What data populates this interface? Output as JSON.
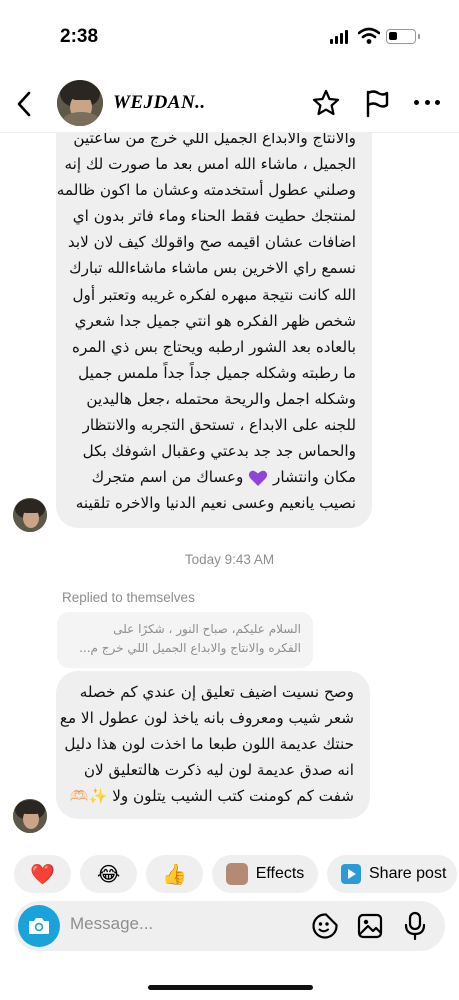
{
  "status_bar": {
    "time": "2:38"
  },
  "header": {
    "contact_name": "WEJDAN.."
  },
  "messages": [
    {
      "id": "msg-1",
      "lines": [
        "والانتاج والابداع الجميل اللي خرج من ساعتين",
        "الجميل ، ماشاء الله امس بعد ما صورت لك إنه",
        "وصلني عطول أستخدمته وعشان ما اكون ظالمه",
        "لمنتجك حطيت فقط الحناء وماء فاتر بدون اي",
        "اضافات عشان اقيمه صح واقولك كيف لان لابد",
        "نسمع راي الاخرين بس ماشاء ماشاءالله تبارك",
        "الله كانت نتيجة مبهره لفكره غريبه وتعتبر أول",
        "شخص ظهر الفكره هو انتي جميل جدا شعري",
        "بالعاده بعد الشور ارطبه ويحتاج بس ذي المره",
        "ما رطبته وشكله جميل جداً جداً ملمس جميل",
        "وشكله اجمل والريحة محتمله ،جعل هاليدين",
        "للجنه على الابداع ، تستحق التجربه والانتظار",
        "والحماس جد جد بدعتي وعقبال اشوفك بكل",
        "مكان وانتشار",
        "وعساك من اسم متجرك",
        "نصيب يانعيم وعسى نعيم الدنيا والاخره تلقينه"
      ]
    },
    {
      "id": "msg-2",
      "lines": [
        "وصح نسيت اضيف تعليق إن عندي كم خصله",
        "شعر شيب ومعروف بانه ياخذ لون عطول الا مع",
        "حنتك عديمة اللون طبعا ما اخذت لون هذا دليل",
        "انه صدق عديمة لون ليه ذكرت هالتعليق لان",
        "شفت كم كومنت كتب الشيب يتلون ولا"
      ],
      "trailing_emoji": "✨🫶🏻"
    }
  ],
  "timestamp": "Today 9:43 AM",
  "replied_label": "Replied to themselves",
  "reply_quote": {
    "line1": "السلام عليكم، صباح النور ، شكرًا على",
    "line2": "الفكره والانتاج والابداع الجميل اللي خرج م..."
  },
  "quick_reactions": [
    {
      "emoji": "❤️",
      "name": "heart"
    },
    {
      "emoji": "😂",
      "name": "laugh"
    },
    {
      "emoji": "👍",
      "name": "thumbs-up"
    }
  ],
  "effects_label": "Effects",
  "share_label": "Share post",
  "composer": {
    "placeholder": "Message..."
  },
  "colors": {
    "accent": "#1aa3d8",
    "bubble": "#efefef",
    "purple_heart": "#8e44d9"
  }
}
